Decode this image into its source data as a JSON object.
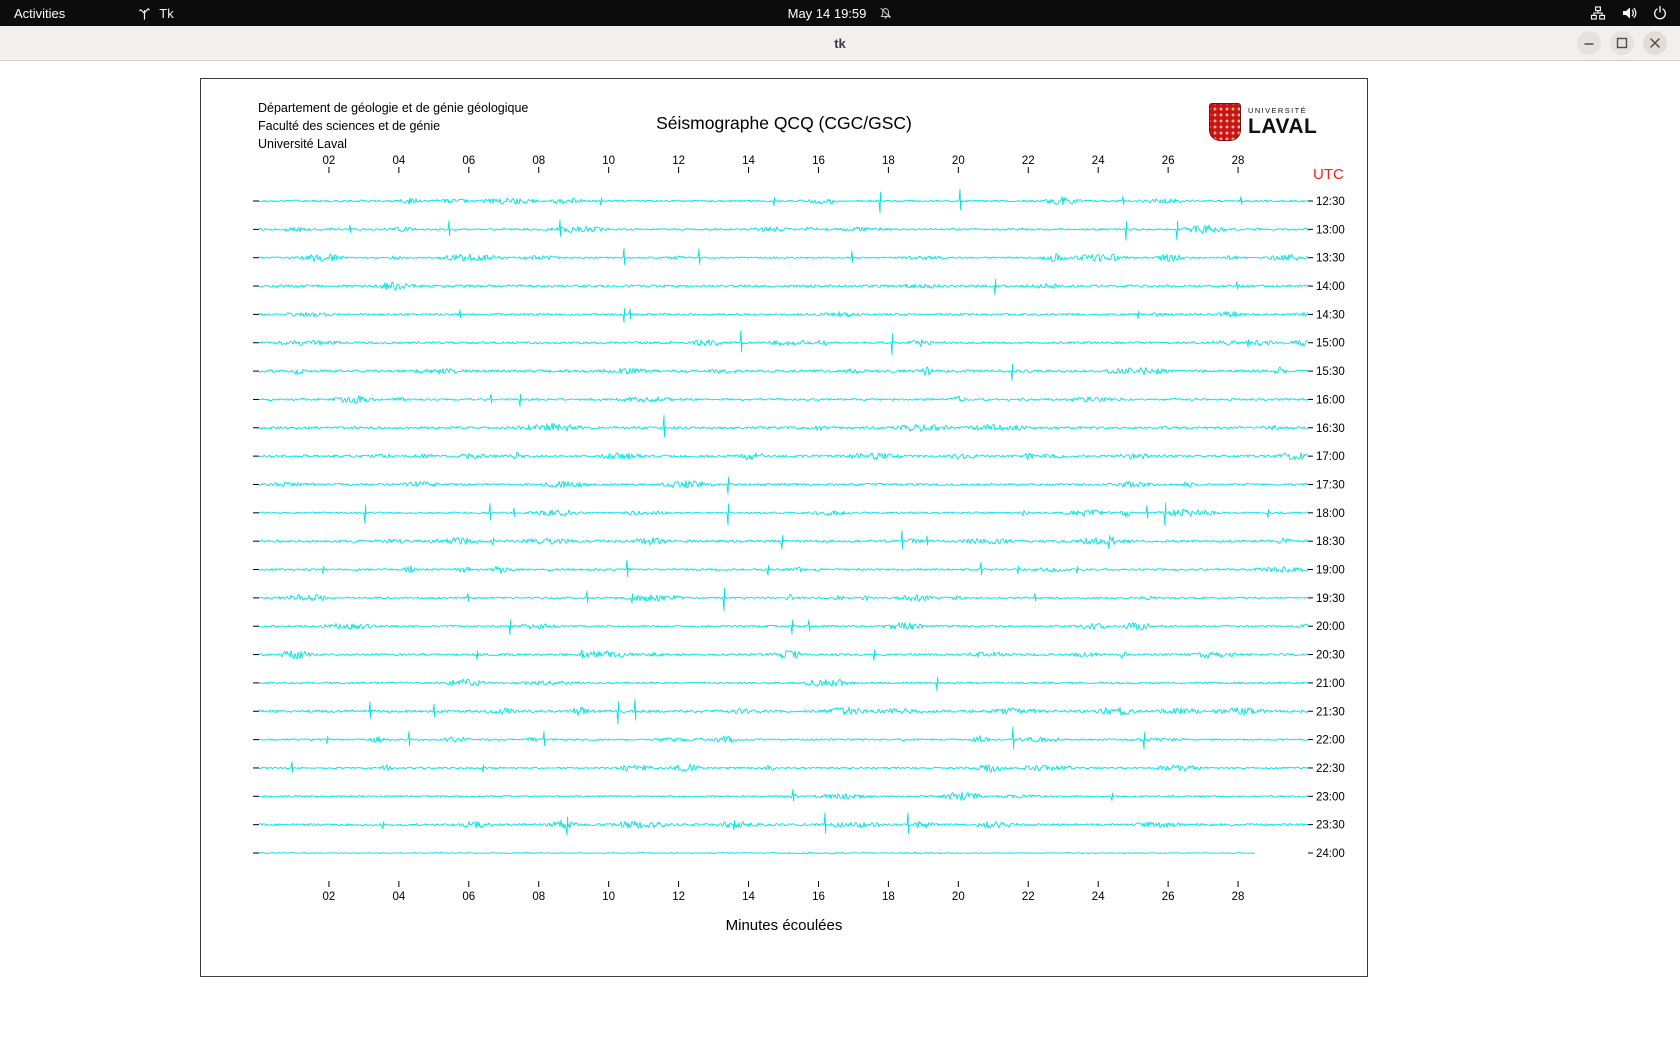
{
  "topbar": {
    "activities_label": "Activities",
    "app_indicator_label": "Tk",
    "clock": "May 14 19:59",
    "icons": [
      "tk-icon",
      "notifications-off-icon",
      "network-icon",
      "volume-icon",
      "power-icon"
    ]
  },
  "window": {
    "title": "tk"
  },
  "header": {
    "line1": "Département de géologie et de génie géologique",
    "line2": "Faculté des sciences et de génie",
    "line3": "Université Laval"
  },
  "logo": {
    "small_text": "UNIVERSITÉ",
    "large_text": "LAVAL",
    "shield_color": "#c8102e",
    "dot_color": "#ffc72c"
  },
  "chart_data": {
    "type": "line",
    "title": "Séismographe QCQ (CGC/GSC)",
    "xlabel": "Minutes écoulées",
    "utc_label": "UTC",
    "utc_color": "#ff1a1a",
    "trace_color": "#00e2e2",
    "x_ticks": [
      "02",
      "04",
      "06",
      "08",
      "10",
      "12",
      "14",
      "16",
      "18",
      "20",
      "22",
      "24",
      "26",
      "28"
    ],
    "x_range_minutes": [
      0,
      30
    ],
    "trace_labels": [
      "12:30",
      "13:00",
      "13:30",
      "14:00",
      "14:30",
      "15:00",
      "15:30",
      "16:00",
      "16:30",
      "17:00",
      "17:30",
      "18:00",
      "18:30",
      "19:00",
      "19:30",
      "20:00",
      "20:30",
      "21:00",
      "21:30",
      "22:00",
      "22:30",
      "23:00",
      "23:30",
      "24:00"
    ],
    "last_trace_end_minute": 28.5
  }
}
